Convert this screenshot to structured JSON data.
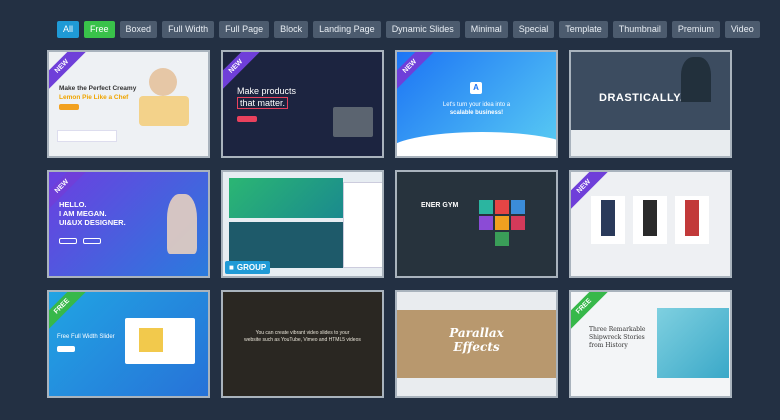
{
  "filters": [
    {
      "label": "All"
    },
    {
      "label": "Free"
    },
    {
      "label": "Boxed"
    },
    {
      "label": "Full Width"
    },
    {
      "label": "Full Page"
    },
    {
      "label": "Block"
    },
    {
      "label": "Landing Page"
    },
    {
      "label": "Dynamic Slides"
    },
    {
      "label": "Minimal"
    },
    {
      "label": "Special"
    },
    {
      "label": "Template"
    },
    {
      "label": "Thumbnail"
    },
    {
      "label": "Premium"
    },
    {
      "label": "Video"
    }
  ],
  "colors": {
    "background": "#233043",
    "all_active": "#1f9ad6",
    "free_active": "#39c24a",
    "ribbon_new": "#6f3fd9",
    "ribbon_free": "#37b84a"
  },
  "cards": [
    {
      "ribbon": "NEW",
      "lines": [
        "Make the Perfect Creamy",
        "Lemon Pie Like a Chef"
      ]
    },
    {
      "ribbon": "NEW",
      "lines": [
        "Make products",
        "that matter."
      ]
    },
    {
      "ribbon": "NEW",
      "lines": [
        "Let's turn your idea into a",
        "scalable business!"
      ]
    },
    {
      "ribbon": "",
      "lines": [
        "DRASTICALLY."
      ]
    },
    {
      "ribbon": "NEW",
      "lines": [
        "HELLO.",
        "I AM MEGAN.",
        "UI&UX DESIGNER."
      ]
    },
    {
      "ribbon": "",
      "lines": [
        "GROUP"
      ]
    },
    {
      "ribbon": "",
      "lines": [
        "ENER GYM"
      ]
    },
    {
      "ribbon": "NEW",
      "lines": []
    },
    {
      "ribbon": "FREE",
      "lines": [
        "Free Full Width Slider"
      ]
    },
    {
      "ribbon": "",
      "lines": [
        "You can create vibrant video slides to your",
        "website such as YouTube, Vimeo and HTML5 videos"
      ]
    },
    {
      "ribbon": "",
      "lines": [
        "Parallax",
        "Effects"
      ]
    },
    {
      "ribbon": "FREE",
      "lines": [
        "Three Remarkable",
        "Shipwreck Stories",
        "from History"
      ]
    }
  ]
}
